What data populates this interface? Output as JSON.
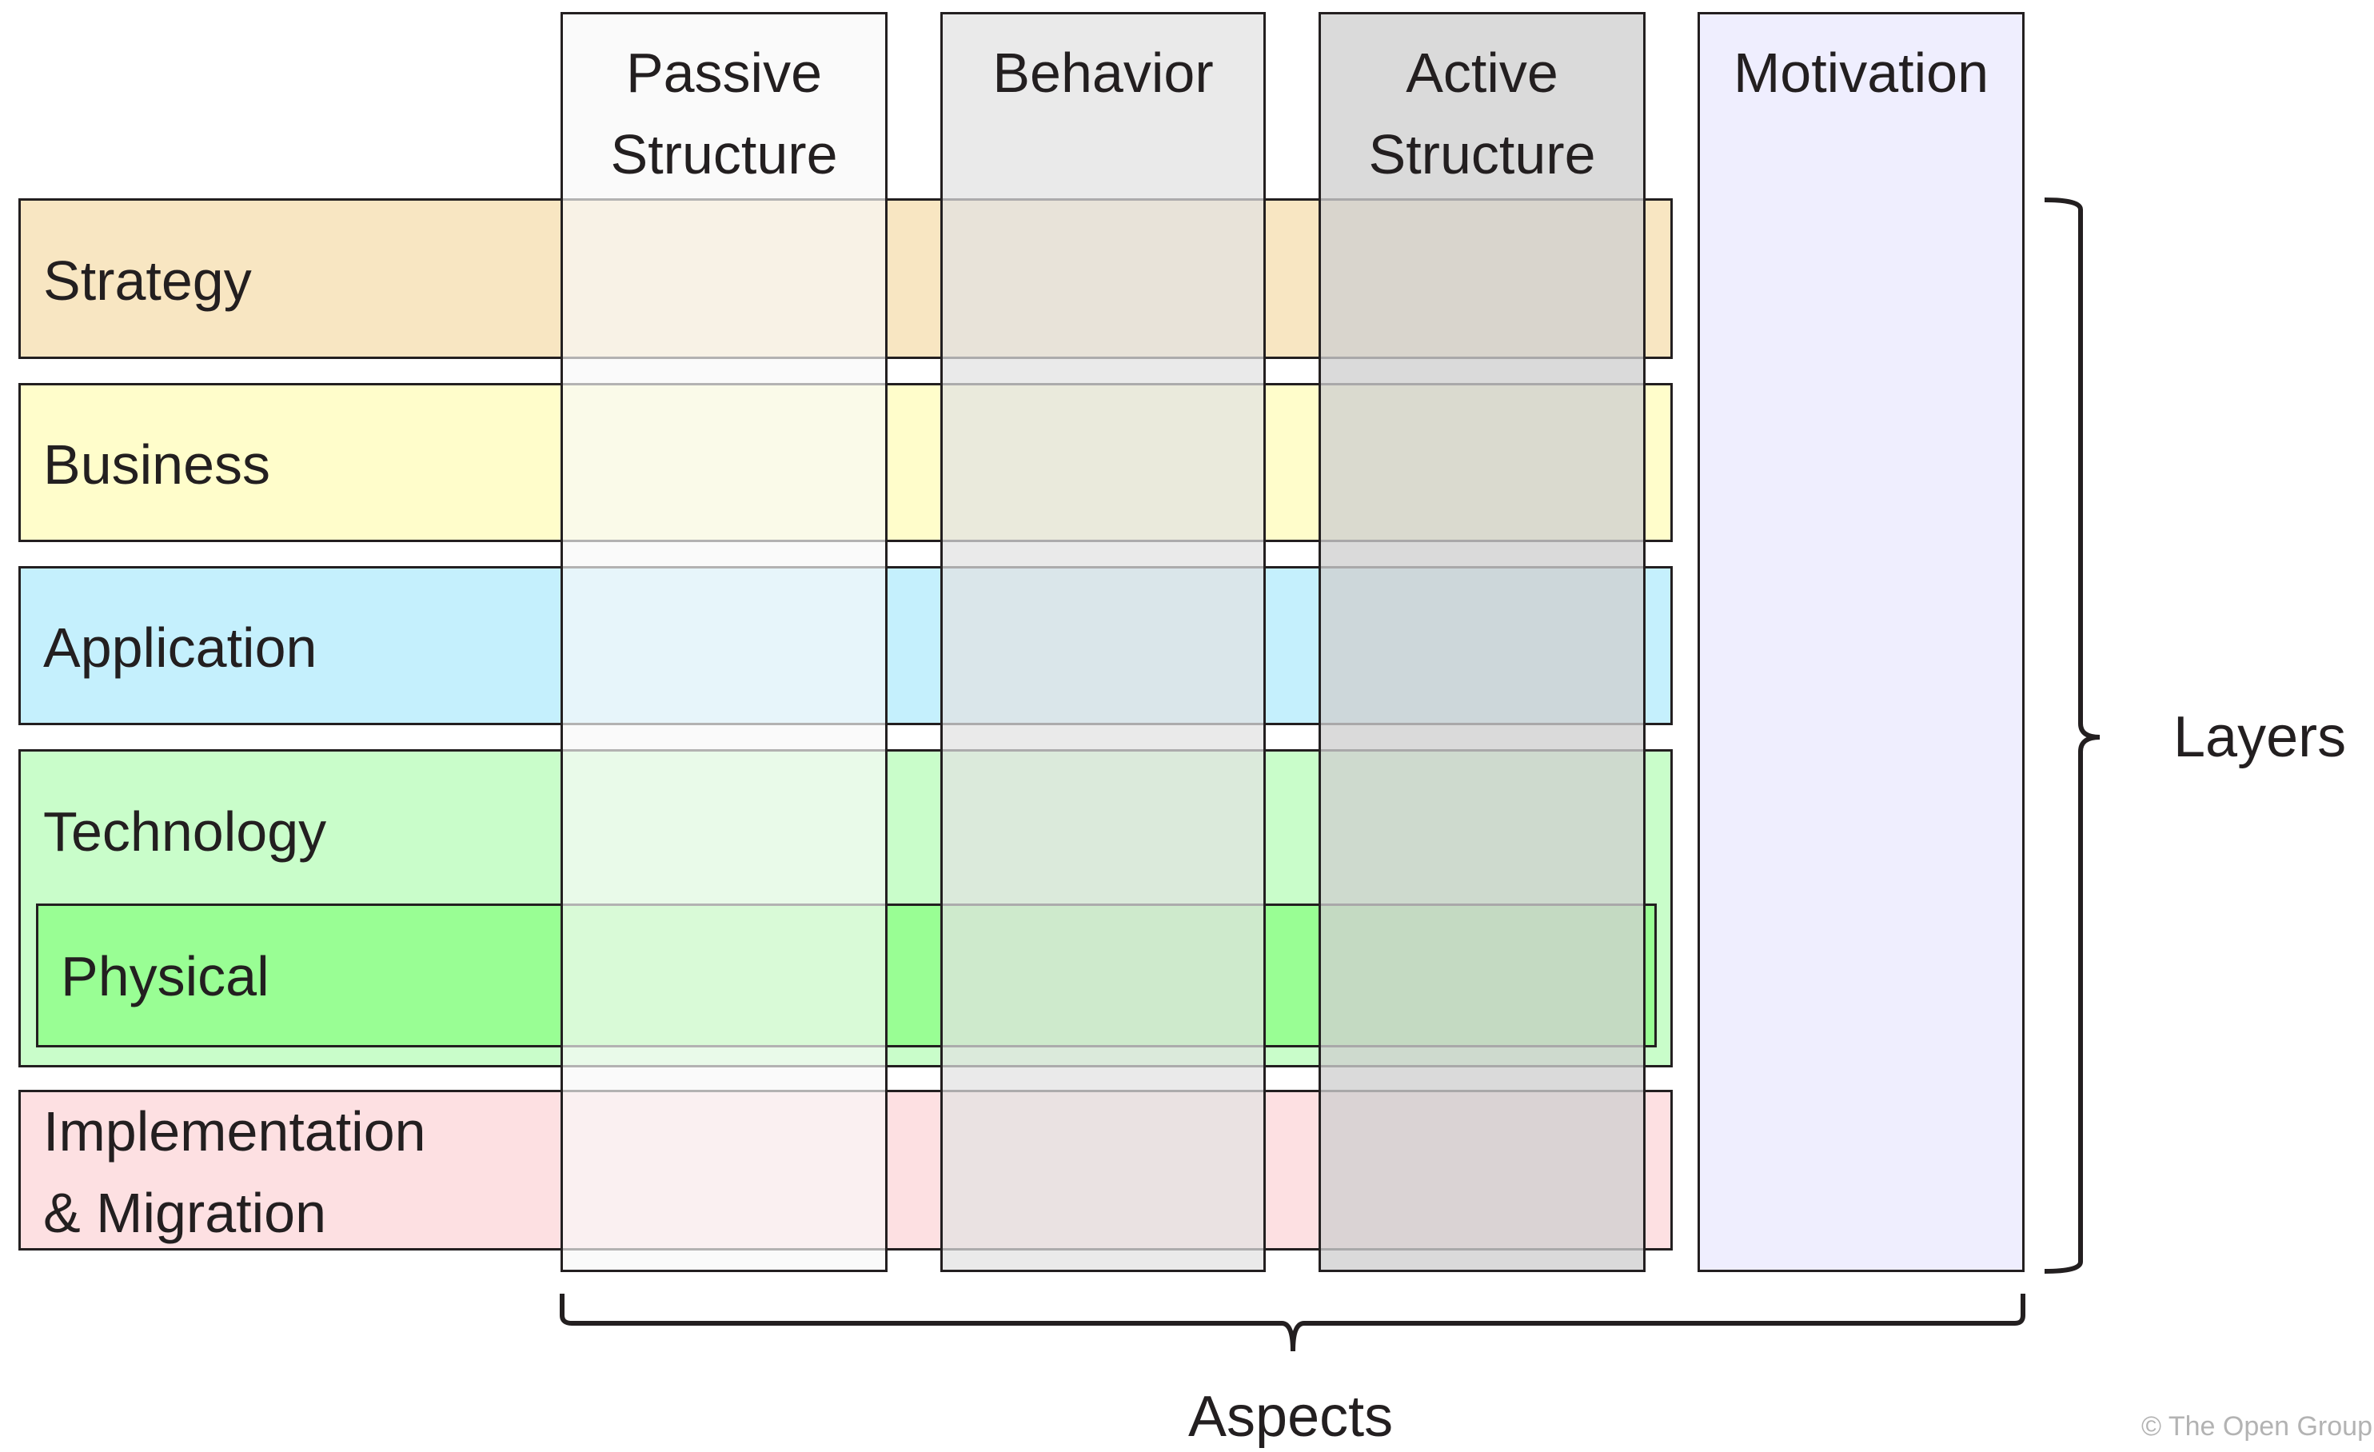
{
  "diagram": {
    "layers": [
      {
        "name": "Strategy",
        "color": "#f8e6c2"
      },
      {
        "name": "Business",
        "color": "#fffdcb"
      },
      {
        "name": "Application",
        "color": "#c5f0fd"
      },
      {
        "name": "Technology",
        "color": "#c9fdca"
      },
      {
        "name": "Implementation\n& Migration",
        "color": "#fde0e2"
      }
    ],
    "sublayer": {
      "name": "Physical",
      "color": "#99fe94",
      "parent": "Technology"
    },
    "aspects": [
      {
        "name": "Passive\nStructure",
        "color": "#f7f7f7"
      },
      {
        "name": "Behavior",
        "color": "#e8e8e8"
      },
      {
        "name": "Active\nStructure",
        "color": "#d6d6d6"
      }
    ],
    "motivation": {
      "name": "Motivation",
      "color": "#efeefe"
    },
    "layers_label": "Layers",
    "aspects_label": "Aspects",
    "copyright": "© The Open Group"
  }
}
